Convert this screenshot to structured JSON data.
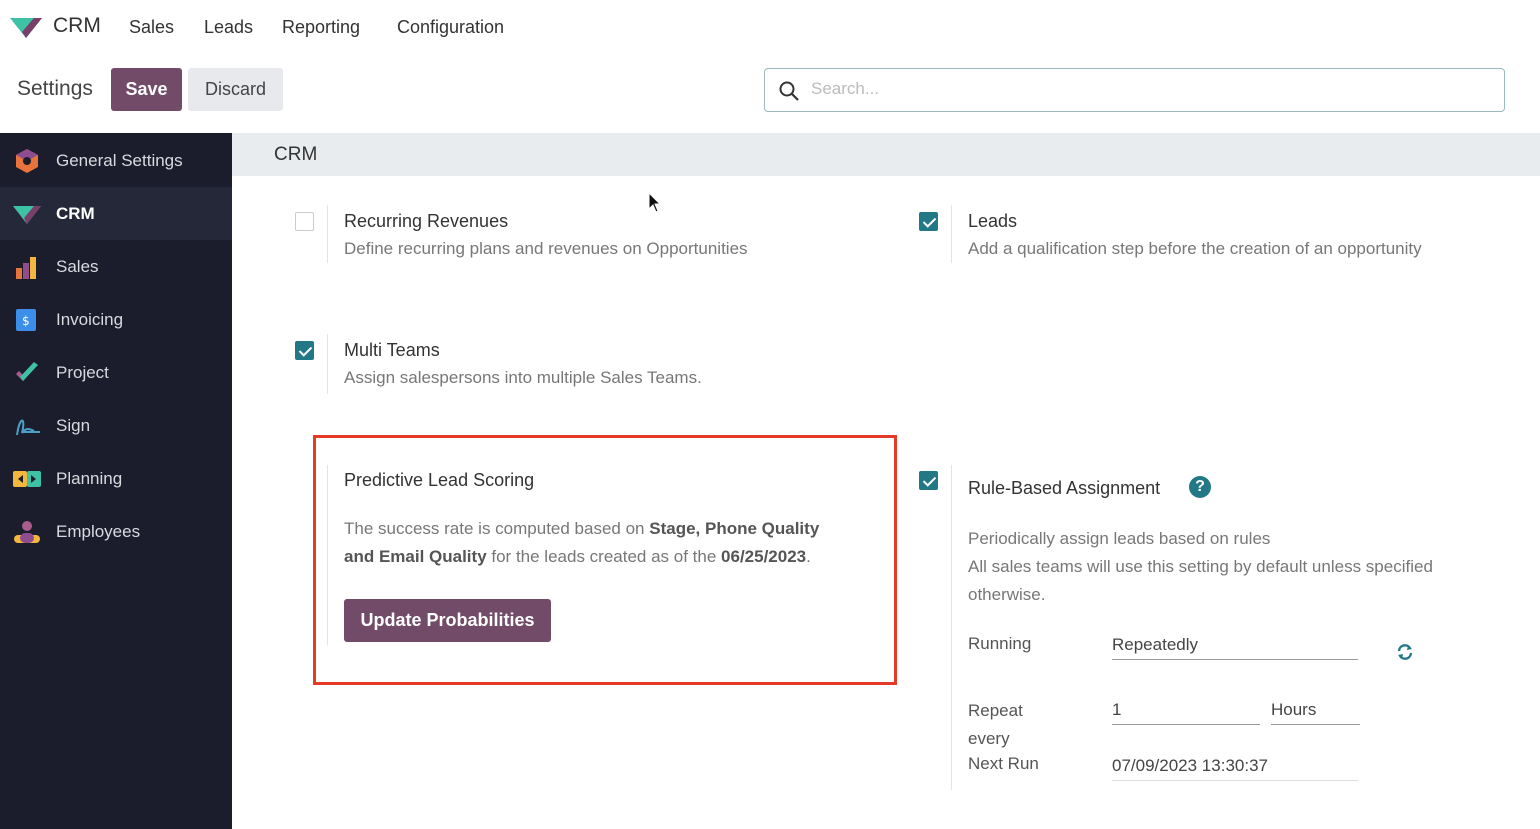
{
  "topnav": {
    "app": "CRM",
    "menu": [
      "Sales",
      "Leads",
      "Reporting",
      "Configuration"
    ]
  },
  "control": {
    "title": "Settings",
    "save": "Save",
    "discard": "Discard",
    "search_placeholder": "Search..."
  },
  "sidebar": {
    "items": [
      {
        "label": "General Settings",
        "icon": "general-settings-icon"
      },
      {
        "label": "CRM",
        "icon": "crm-icon",
        "active": true
      },
      {
        "label": "Sales",
        "icon": "sales-icon"
      },
      {
        "label": "Invoicing",
        "icon": "invoicing-icon"
      },
      {
        "label": "Project",
        "icon": "project-icon"
      },
      {
        "label": "Sign",
        "icon": "sign-icon"
      },
      {
        "label": "Planning",
        "icon": "planning-icon"
      },
      {
        "label": "Employees",
        "icon": "employees-icon"
      }
    ]
  },
  "section": {
    "title": "CRM"
  },
  "settings": {
    "recurring": {
      "title": "Recurring Revenues",
      "desc": "Define recurring plans and revenues on Opportunities",
      "checked": false
    },
    "leads": {
      "title": "Leads",
      "desc": "Add a qualification step before the creation of an opportunity",
      "checked": true
    },
    "multi_teams": {
      "title": "Multi Teams",
      "desc": "Assign salespersons into multiple Sales Teams.",
      "checked": true
    },
    "pls": {
      "title": "Predictive Lead Scoring",
      "desc": [
        "The success rate is computed based on ",
        "Stage, Phone Quality",
        " and Email Quality",
        " for the leads created as of the ",
        "06/25/2023",
        "."
      ],
      "button": "Update Probabilities"
    },
    "rba": {
      "title": "Rule-Based Assignment",
      "help": "?",
      "checked": true,
      "desc1": "Periodically assign leads based on rules",
      "desc2": "All sales teams will use this setting by default unless specified otherwise.",
      "running_label": "Running",
      "running_value": "Repeatedly",
      "repeat_label": "Repeat every",
      "repeat_value": "1",
      "repeat_unit": "Hours",
      "next_label": "Next Run",
      "next_value": "07/09/2023 13:30:37"
    }
  },
  "colors": {
    "primary": "#714b67",
    "teal": "#227985",
    "highlight": "#e53a25",
    "sidebar": "#1b1d2c"
  }
}
